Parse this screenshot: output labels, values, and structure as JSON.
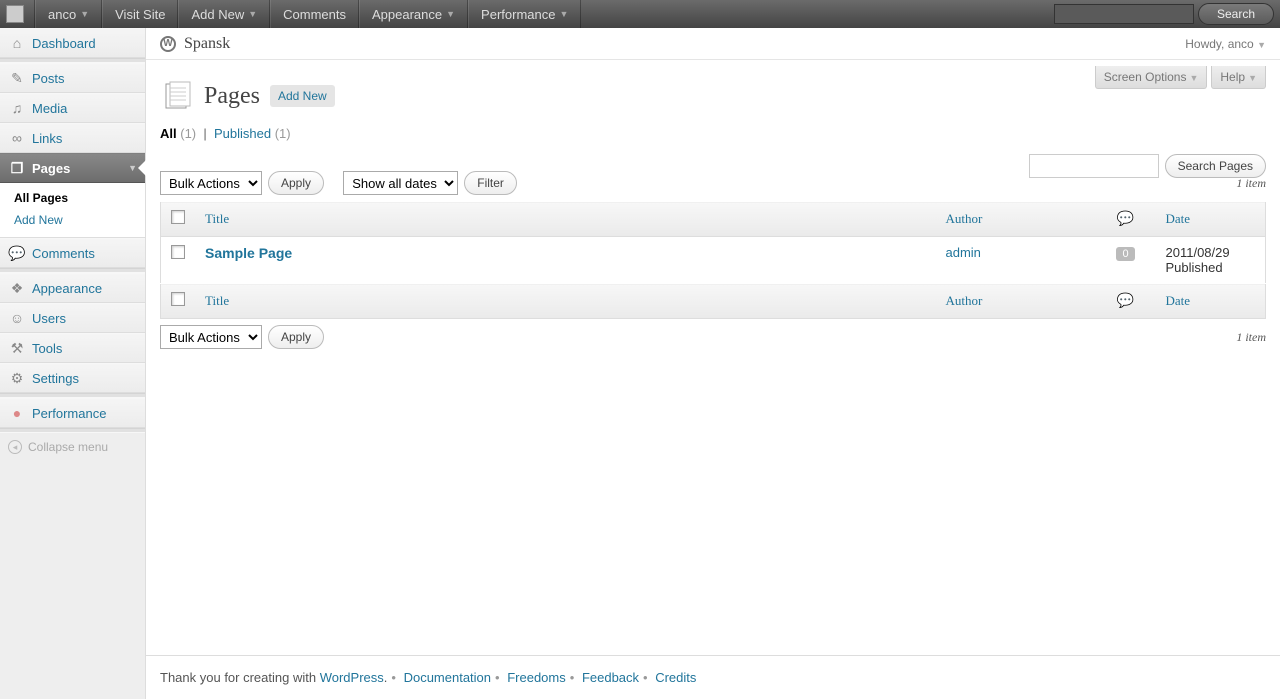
{
  "adminbar": {
    "user": "anco",
    "items": [
      "Visit Site",
      "Add New",
      "Comments",
      "Appearance",
      "Performance"
    ],
    "searchBtn": "Search"
  },
  "greeting": "Howdy, anco",
  "siteTitle": "Spansk",
  "screenOptions": "Screen Options",
  "help": "Help",
  "sidebar": {
    "dashboard": "Dashboard",
    "posts": "Posts",
    "media": "Media",
    "links": "Links",
    "pages": "Pages",
    "allPages": "All Pages",
    "addNew": "Add New",
    "comments": "Comments",
    "appearance": "Appearance",
    "users": "Users",
    "tools": "Tools",
    "settings": "Settings",
    "performance": "Performance",
    "collapse": "Collapse menu"
  },
  "page": {
    "title": "Pages",
    "addNew": "Add New",
    "filterAll": "All",
    "filterAllCount": "(1)",
    "filterPublished": "Published",
    "filterPublishedCount": "(1)",
    "searchBtn": "Search Pages",
    "bulkActions": "Bulk Actions",
    "apply": "Apply",
    "dateFilter": "Show all dates",
    "filter": "Filter",
    "itemCount": "1 item"
  },
  "columns": {
    "title": "Title",
    "author": "Author",
    "date": "Date"
  },
  "rows": [
    {
      "title": "Sample Page",
      "author": "admin",
      "comments": "0",
      "date": "2011/08/29",
      "status": "Published"
    }
  ],
  "footer": {
    "thank": "Thank you for creating with ",
    "wp": "WordPress",
    "links": [
      "Documentation",
      "Freedoms",
      "Feedback",
      "Credits"
    ]
  }
}
